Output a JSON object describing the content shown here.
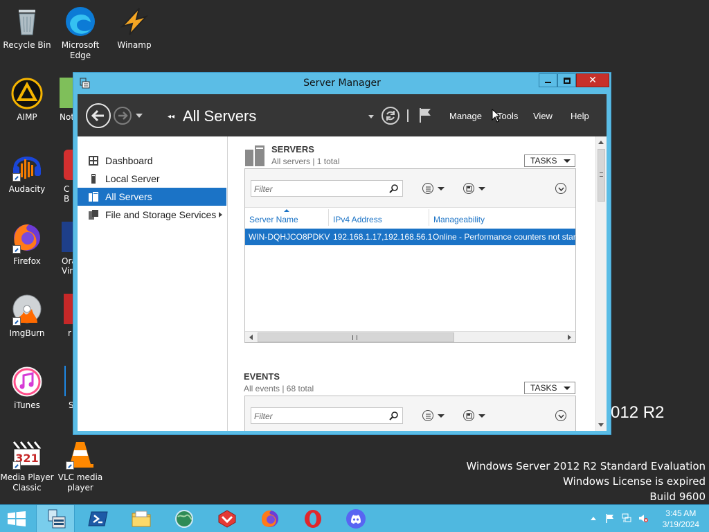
{
  "desktop": {
    "icons": [
      {
        "label": "Recycle Bin"
      },
      {
        "label": "Microsoft Edge"
      },
      {
        "label": "Winamp"
      },
      {
        "label": "AIMP"
      },
      {
        "label": "Audacity"
      },
      {
        "label": "Firefox"
      },
      {
        "label": "ImgBurn"
      },
      {
        "label": "iTunes"
      },
      {
        "label": "Media Player Classic"
      },
      {
        "label": "VLC media player"
      }
    ],
    "partial_labels": [
      "Not",
      "C",
      "B",
      "Ora",
      "Vir",
      "r",
      "S"
    ],
    "watermark": {
      "big": "012 R2",
      "line1": "Windows Server 2012 R2 Standard Evaluation",
      "line2": "Windows License is expired",
      "line3": "Build 9600"
    }
  },
  "window": {
    "title": "Server Manager",
    "breadcrumb": "All Servers",
    "menu": {
      "manage": "Manage",
      "tools": "Tools",
      "view": "View",
      "help": "Help"
    }
  },
  "sidebar": {
    "items": [
      {
        "label": "Dashboard"
      },
      {
        "label": "Local Server"
      },
      {
        "label": "All Servers"
      },
      {
        "label": "File and Storage Services"
      }
    ]
  },
  "servers": {
    "title": "SERVERS",
    "subtitle": "All servers | 1 total",
    "tasks": "TASKS",
    "filter_placeholder": "Filter",
    "columns": [
      "Server Name",
      "IPv4 Address",
      "Manageability"
    ],
    "rows": [
      {
        "name": "WIN-DQHJCO8PDKV",
        "ip": "192.168.1.17,192.168.56.1",
        "manageability": "Online - Performance counters not started"
      }
    ]
  },
  "events": {
    "title": "EVENTS",
    "subtitle": "All events | 68 total",
    "tasks": "TASKS",
    "filter_placeholder": "Filter"
  },
  "taskbar": {
    "time": "3:45 AM",
    "date": "3/19/2024"
  },
  "colors": {
    "accent": "#1b73c6",
    "window_frame": "#5bbde6",
    "toolbar": "#363636",
    "taskbar": "#4fb8e0"
  }
}
